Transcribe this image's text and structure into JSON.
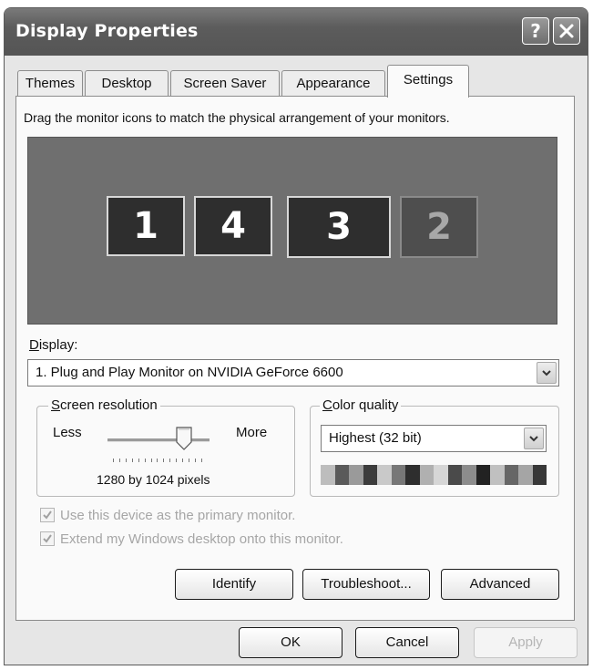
{
  "window": {
    "title": "Display Properties",
    "help_label": "?"
  },
  "tabs": [
    {
      "label": "Themes"
    },
    {
      "label": "Desktop"
    },
    {
      "label": "Screen Saver"
    },
    {
      "label": "Appearance"
    },
    {
      "label": "Settings",
      "active": true
    }
  ],
  "settings": {
    "instruction": "Drag the monitor icons to match the physical arrangement of your monitors.",
    "monitors": [
      {
        "label": "1",
        "active": true
      },
      {
        "label": "4",
        "active": true
      },
      {
        "label": "3",
        "active": true
      },
      {
        "label": "2",
        "active": false
      }
    ],
    "display_label": "Display:",
    "display_value": "1. Plug and Play Monitor on NVIDIA GeForce 6600",
    "resolution": {
      "group_label": "Screen resolution",
      "less_label": "Less",
      "more_label": "More",
      "value_text": "1280 by 1024 pixels",
      "slider_level": 0.75
    },
    "color_quality": {
      "group_label": "Color quality",
      "selected": "Highest (32 bit)"
    },
    "primary_monitor_label": "Use this device as the primary monitor.",
    "extend_desktop_label": "Extend my Windows desktop onto this monitor.",
    "buttons": {
      "identify": "Identify",
      "troubleshoot": "Troubleshoot...",
      "advanced": "Advanced"
    }
  },
  "footer": {
    "ok": "OK",
    "cancel": "Cancel",
    "apply": "Apply"
  },
  "colors": {
    "titlebar": "#5c5c5c",
    "monitor_area": "#6f6f6f",
    "monitor_active": "#2e2e2e",
    "monitor_inactive": "#4e4e4e"
  }
}
